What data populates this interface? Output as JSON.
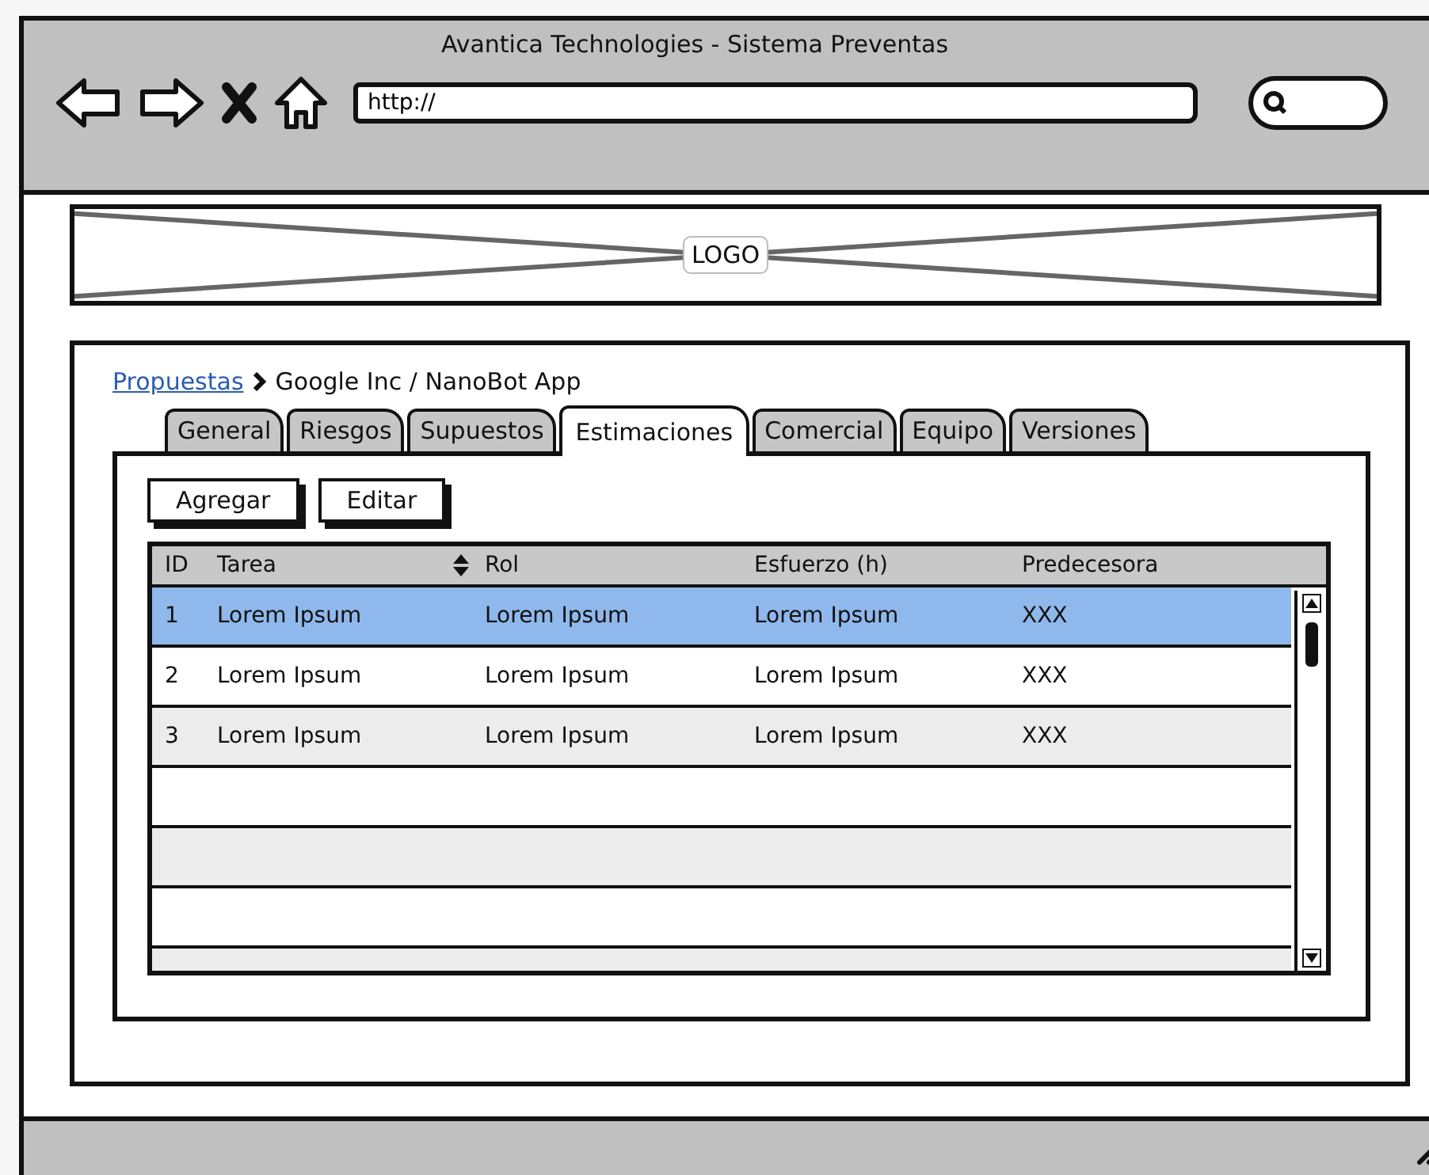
{
  "window": {
    "title": "Avantica Technologies - Sistema Preventas"
  },
  "address_bar": {
    "value": "http://"
  },
  "logo": {
    "label": "LOGO"
  },
  "breadcrumb": {
    "link": "Propuestas",
    "current": "Google Inc / NanoBot App"
  },
  "tabs": [
    {
      "label": "General",
      "selected": false
    },
    {
      "label": "Riesgos",
      "selected": false
    },
    {
      "label": "Supuestos",
      "selected": false
    },
    {
      "label": "Estimaciones",
      "selected": true
    },
    {
      "label": "Comercial",
      "selected": false
    },
    {
      "label": "Equipo",
      "selected": false
    },
    {
      "label": "Versiones",
      "selected": false
    }
  ],
  "buttons": [
    "Agregar",
    "Editar"
  ],
  "table": {
    "columns": [
      {
        "label": "ID",
        "sortable": false
      },
      {
        "label": "Tarea",
        "sortable": true
      },
      {
        "label": "Rol",
        "sortable": false
      },
      {
        "label": "Esfuerzo (h)",
        "sortable": false
      },
      {
        "label": "Predecesora",
        "sortable": false
      }
    ],
    "rows": [
      {
        "cells": [
          "1",
          "Lorem Ipsum",
          "Lorem Ipsum",
          "Lorem Ipsum",
          "XXX"
        ],
        "selected": true
      },
      {
        "cells": [
          "2",
          "Lorem Ipsum",
          "Lorem Ipsum",
          "Lorem Ipsum",
          "XXX"
        ],
        "selected": false
      },
      {
        "cells": [
          "3",
          "Lorem Ipsum",
          "Lorem Ipsum",
          "Lorem Ipsum",
          "XXX"
        ],
        "selected": false
      }
    ]
  }
}
